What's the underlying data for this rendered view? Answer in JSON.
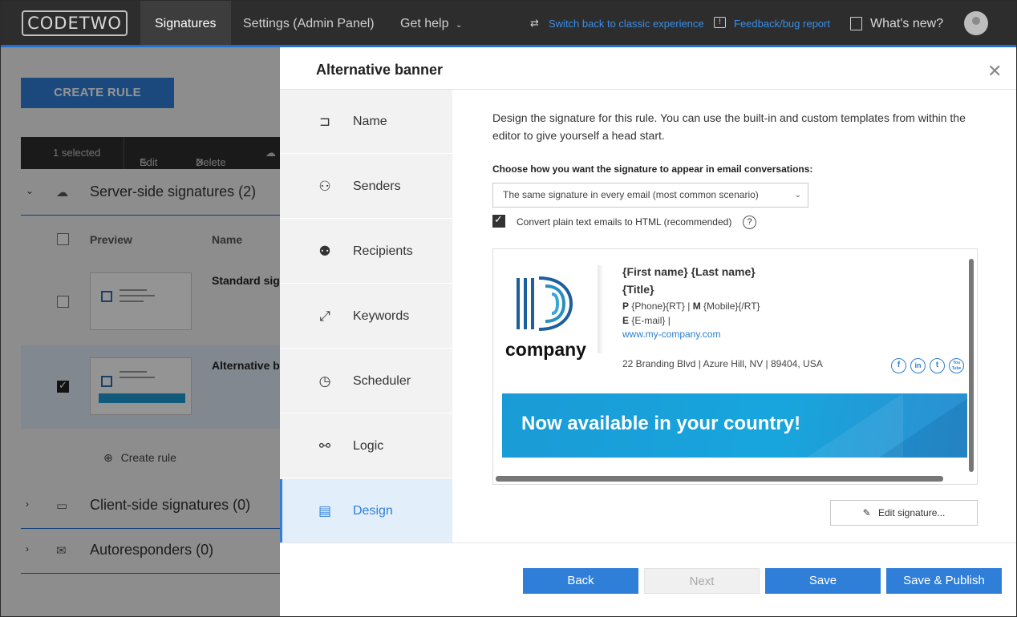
{
  "topbar": {
    "logo": "CODETWO",
    "nav": [
      {
        "label": "Signatures"
      },
      {
        "label": "Settings (Admin Panel)"
      },
      {
        "label": "Get help"
      }
    ],
    "switch_link": "Switch back to classic experience",
    "feedback_link": "Feedback/bug report",
    "whats_new": "What's new?"
  },
  "background": {
    "create_rule": "CREATE RULE",
    "actionbar": {
      "selected": "1 selected",
      "edit": "Edit",
      "delete": "Delete"
    },
    "sections": [
      {
        "label": "Server-side signatures (2)"
      },
      {
        "label": "Client-side signatures (0)"
      },
      {
        "label": "Autoresponders (0)"
      }
    ],
    "columns": {
      "preview": "Preview",
      "name": "Name"
    },
    "rows": [
      {
        "name": "Standard sig",
        "checked": false
      },
      {
        "name": "Alternative b",
        "checked": true
      }
    ],
    "create_rule_link": "Create rule"
  },
  "dialog": {
    "title": "Alternative banner",
    "steps": [
      {
        "label": "Name",
        "icon": "signpost-icon"
      },
      {
        "label": "Senders",
        "icon": "senders-icon"
      },
      {
        "label": "Recipients",
        "icon": "recipients-icon"
      },
      {
        "label": "Keywords",
        "icon": "keywords-icon"
      },
      {
        "label": "Scheduler",
        "icon": "clock-icon"
      },
      {
        "label": "Logic",
        "icon": "logic-icon"
      },
      {
        "label": "Design",
        "icon": "design-icon",
        "active": true
      }
    ],
    "intro": "Design the signature for this rule. You can use the built-in and custom templates from within the editor to give yourself a head start.",
    "choose_label": "Choose how you want the signature to appear in email conversations:",
    "select_value": "The same signature in every email (most common scenario)",
    "convert_label": "Convert plain text emails to HTML (recommended)",
    "convert_checked": true,
    "help": "?",
    "edit_signature": "Edit signature...",
    "buttons": {
      "back": "Back",
      "next": "Next",
      "save": "Save",
      "save_publish": "Save & Publish"
    }
  },
  "signature": {
    "logo_word": "company",
    "name": "{First name} {Last name}",
    "title": "{Title}",
    "phone_prefix": "P",
    "phone": "{Phone}{RT}",
    "separator": "|",
    "mobile_prefix": "M",
    "mobile": "{Mobile}{/RT}",
    "email_prefix": "E",
    "email": "{E-mail} |",
    "website": "www.my-company.com",
    "address": "22 Branding Blvd | Azure Hill, NV | 89404, USA",
    "social": [
      "f",
      "in",
      "t",
      "You Tube"
    ],
    "banner": "Now available in your country!"
  },
  "colors": {
    "accent": "#2f7fd9",
    "topbar": "#2d2d2d",
    "banner": "#1a9bd6",
    "logo_blue": "#1d5f9c"
  }
}
